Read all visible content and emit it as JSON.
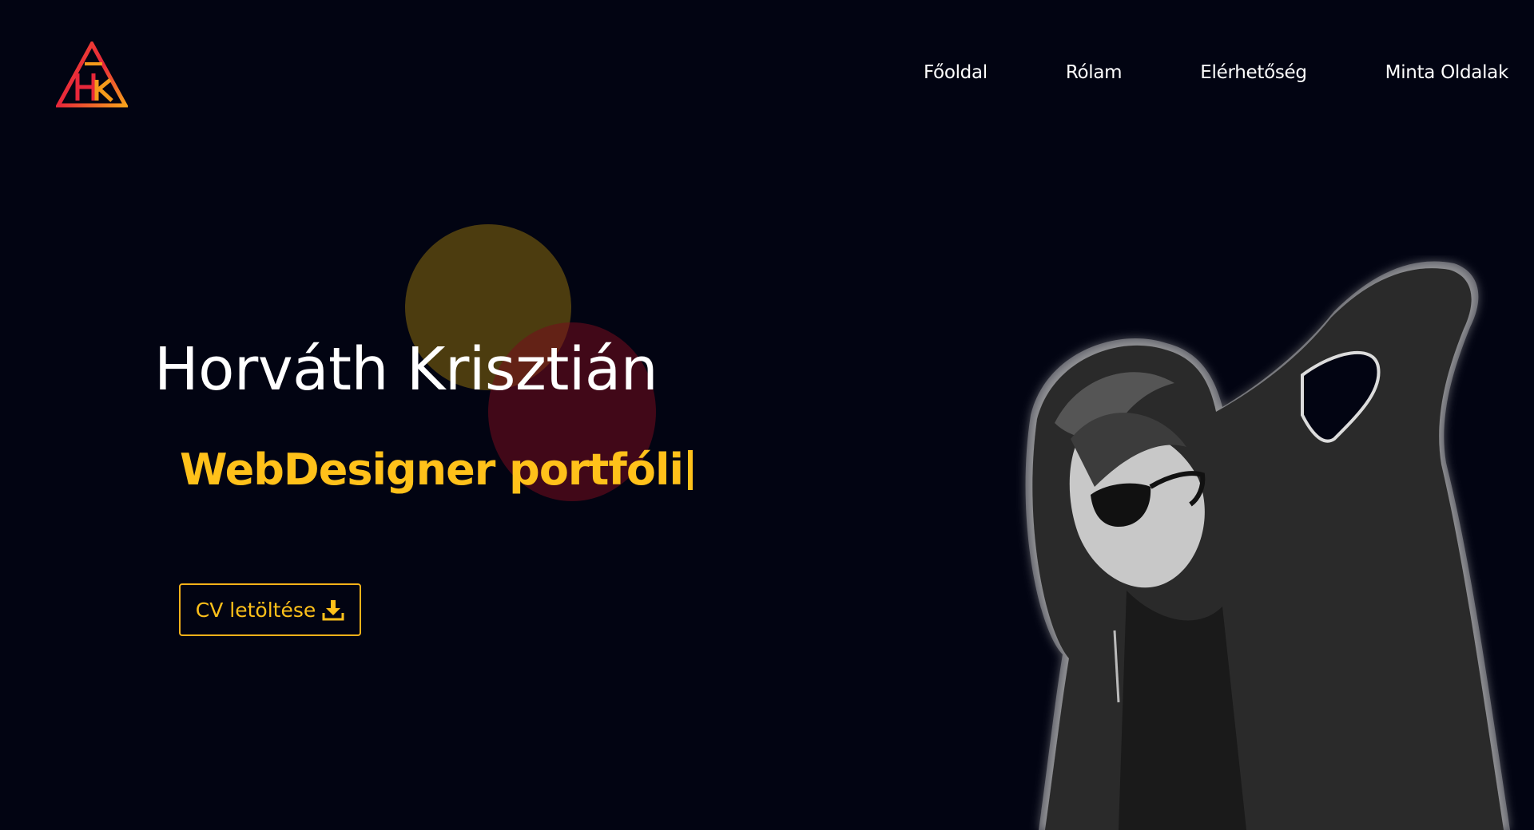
{
  "nav": {
    "items": [
      "Főoldal",
      "Rólam",
      "Elérhetőség",
      "Minta Oldalak"
    ]
  },
  "hero": {
    "name": "Horváth Krisztián",
    "subtitle": "WebDesigner portfóli",
    "cv_button": "CV letöltése"
  },
  "icons": {
    "logo": "logo-icon",
    "download": "download-icon"
  },
  "colors": {
    "background": "#020412",
    "accent": "#ffc11a",
    "logo_red": "#e8273a",
    "logo_orange": "#f59a1b"
  }
}
